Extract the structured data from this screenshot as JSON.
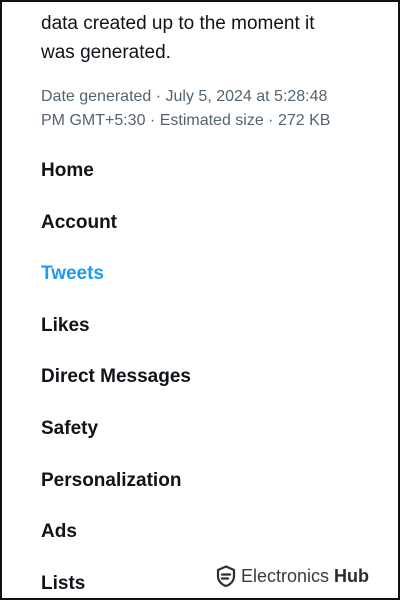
{
  "intro_lines": [
    "data created up to the moment it",
    "was generated."
  ],
  "meta_lines": [
    "Date generated · July 5, 2024 at 5:28:48",
    "PM GMT+5:30 · Estimated size · 272 KB"
  ],
  "nav": {
    "active": "Tweets",
    "items": [
      {
        "label": "Home"
      },
      {
        "label": "Account"
      },
      {
        "label": "Tweets"
      },
      {
        "label": "Likes"
      },
      {
        "label": "Direct Messages"
      },
      {
        "label": "Safety"
      },
      {
        "label": "Personalization"
      },
      {
        "label": "Ads"
      },
      {
        "label": "Lists"
      }
    ]
  },
  "watermark": {
    "brand": "Electronics",
    "brand_suffix": "Hub",
    "logo_icon": "electronics-hub-logo-icon"
  },
  "colors": {
    "text": "#0f1419",
    "muted": "#536471",
    "accent": "#1d9bf0",
    "border": "#111111"
  }
}
